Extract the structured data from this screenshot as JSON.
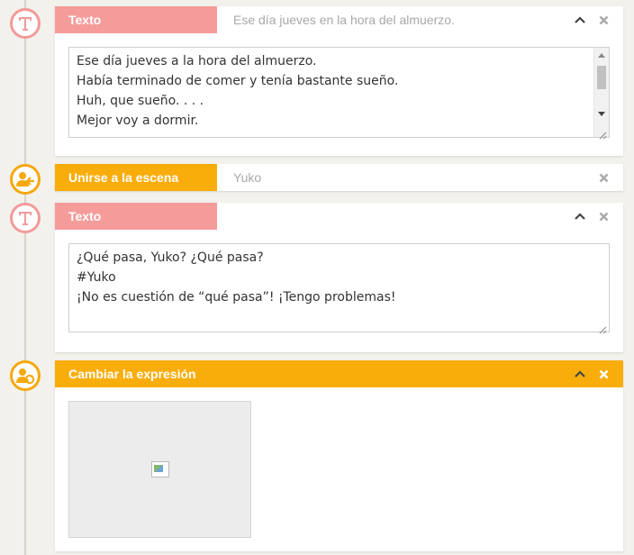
{
  "blocks": [
    {
      "type": "text",
      "title": "Texto",
      "summary": "Ese día jueves en la hora del almuerzo.",
      "content": "Ese día jueves a la hora del almuerzo.\nHabía terminado de comer y tenía bastante sueño.\nHuh, que sueño. . . .\nMejor voy a dormir."
    },
    {
      "type": "join-scene",
      "title": "Unirse a la escena",
      "summary": "Yuko"
    },
    {
      "type": "text",
      "title": "Texto",
      "summary": "",
      "content": "¿Qué pasa, Yuko? ¿Qué pasa?\n#Yuko\n¡No es cuestión de “qué pasa”! ¡Tengo problemas!"
    },
    {
      "type": "change-expression",
      "title": "Cambiar la expresión"
    }
  ],
  "colors": {
    "text_block": "#f59c9b",
    "scene_block": "#f9ad0b",
    "timeline": "#d7d3cb"
  },
  "icons": {
    "text": "letter-t-icon",
    "join": "person-enter-icon",
    "expression": "person-refresh-icon",
    "collapse": "chevron-up-icon",
    "delete": "close-x-icon"
  }
}
